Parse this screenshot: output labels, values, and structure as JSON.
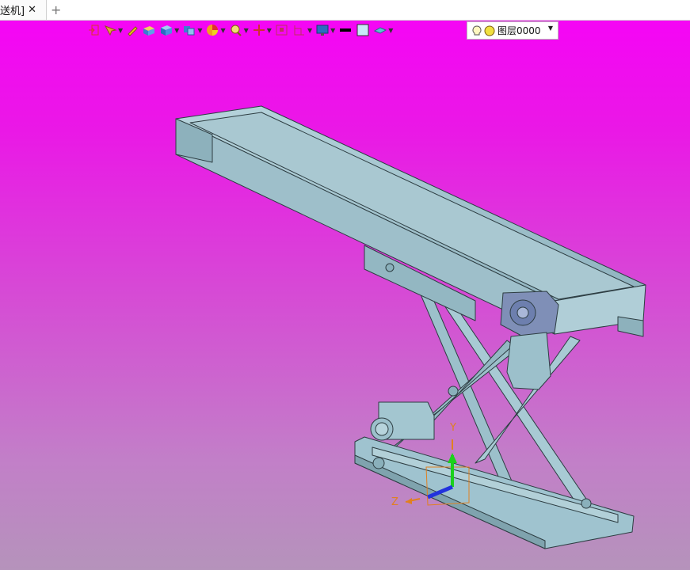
{
  "tab": {
    "label": "送机]",
    "close_glyph": "✕",
    "add_glyph": "+"
  },
  "toolbar": {
    "icons": [
      "exit-icon",
      "select-filter-icon",
      "pencil-icon",
      "box-icon",
      "cube-icon",
      "view-orient-icon",
      "color-wheel-icon",
      "zoom-icon",
      "move-icon",
      "fit-view-icon",
      "section-icon",
      "display-icon",
      "line-color-icon",
      "fill-color-icon",
      "plane-icon"
    ],
    "layer_dropdown": {
      "value": "图层0000",
      "icons": [
        "bulb-icon",
        "sun-icon"
      ]
    }
  },
  "triad": {
    "y_label": "Y",
    "z_label": "Z"
  },
  "colors": {
    "viewport_top": "#f505f5",
    "viewport_bottom": "#b593bb",
    "model_fill": "#9fc3cf",
    "model_edge": "#2d3d42",
    "triad_green": "#1bd11b",
    "triad_blue": "#2233dd",
    "triad_orange": "#e08020"
  }
}
